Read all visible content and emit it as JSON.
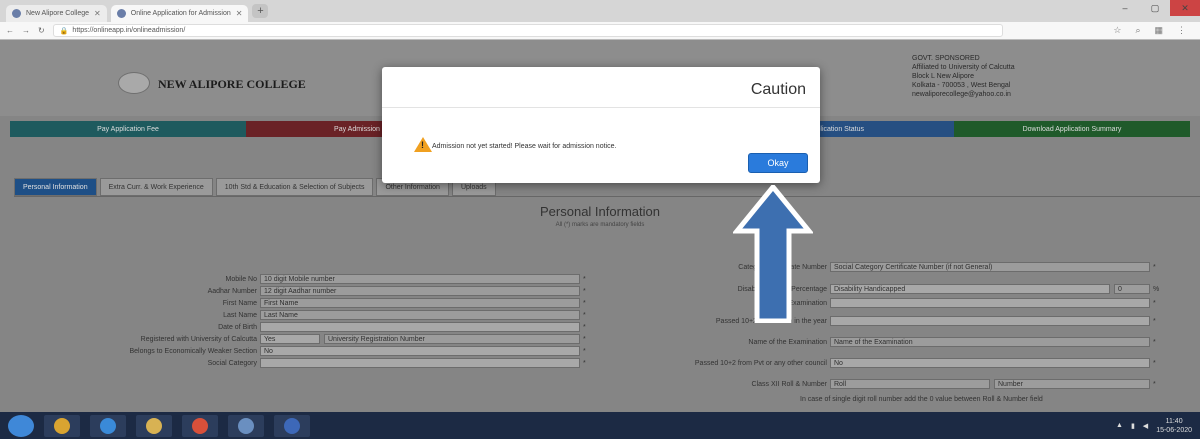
{
  "browser": {
    "tabs": [
      {
        "title": "New Alipore College",
        "active": false
      },
      {
        "title": "Online Application for Admission",
        "active": true
      }
    ],
    "url": "https://onlineapp.in/onlineadmission/"
  },
  "header": {
    "college_name": "NEW ALIPORE COLLEGE",
    "address_lines": [
      "GOVT. SPONSORED",
      "Affiliated to University of Calcutta",
      "Block L New Alipore",
      "Kolkata - 700053 , West Bengal",
      "newaliporecollege@yahoo.co.in"
    ]
  },
  "nav": [
    {
      "label": "Pay Application Fee",
      "color": "#1e5a5e"
    },
    {
      "label": "Pay Admission Fee",
      "color": "#6a2226"
    },
    {
      "label": "",
      "color": "#6f6f6f"
    },
    {
      "label": "Application Status",
      "color": "#264f82"
    },
    {
      "label": "Download Application Summary",
      "color": "#1f5a2a"
    }
  ],
  "form_tabs": [
    {
      "label": "Personal Information",
      "active": true
    },
    {
      "label": "Extra Curr. & Work Experience",
      "active": false
    },
    {
      "label": "10th Std & Education & Selection of Subjects",
      "active": false
    },
    {
      "label": "Other Information",
      "active": false
    },
    {
      "label": "Uploads",
      "active": false
    }
  ],
  "form": {
    "title": "Personal Information",
    "mandatory_note": "All (*) marks are mandatory fields",
    "left_fields": [
      {
        "label": "Mobile No",
        "value": "10 digit Mobile number"
      },
      {
        "label": "Aadhar Number",
        "value": "12 digit Aadhar number"
      },
      {
        "label": "First Name",
        "value": "First Name"
      },
      {
        "label": "Last Name",
        "value": "Last Name"
      },
      {
        "label": "Date of Birth",
        "value": ""
      },
      {
        "label": "Registered with University of Calcutta",
        "value": "Yes",
        "extra": "University Registration Number"
      },
      {
        "label": "Belongs to Economically Weaker Section",
        "value": "No"
      },
      {
        "label": "Social Category",
        "value": ""
      }
    ],
    "right_fields": [
      {
        "label": "Category Certificate Number",
        "value": "Social Category Certificate Number (if not General)"
      },
      {
        "label": "Disability Type & Percentage",
        "value": "Disability Handicapped",
        "extra": "0"
      },
      {
        "label": "Board of Examination",
        "value": ""
      },
      {
        "label": "Passed 10+2 level exam in the year",
        "value": ""
      },
      {
        "label": "Name of the Examination",
        "value": "Name of the Examination"
      },
      {
        "label": "Passed 10+2 from Pvt or any other council",
        "value": "No"
      },
      {
        "label": "Class XII Roll & Number",
        "value": "Roll",
        "extra": "Number"
      }
    ],
    "roll_note": "In case of single digit roll number add the 0 value between Roll & Number field"
  },
  "dialog": {
    "title": "Caution",
    "message": "Admission not yet started! Please wait for admission notice.",
    "button": "Okay",
    "icon": "warning-triangle-icon"
  },
  "colors": {
    "dialog_button": "#2a7bdc",
    "arrow": "#3d6fb0"
  },
  "taskbar": {
    "time": "11:40",
    "date": "15-06-2020"
  }
}
